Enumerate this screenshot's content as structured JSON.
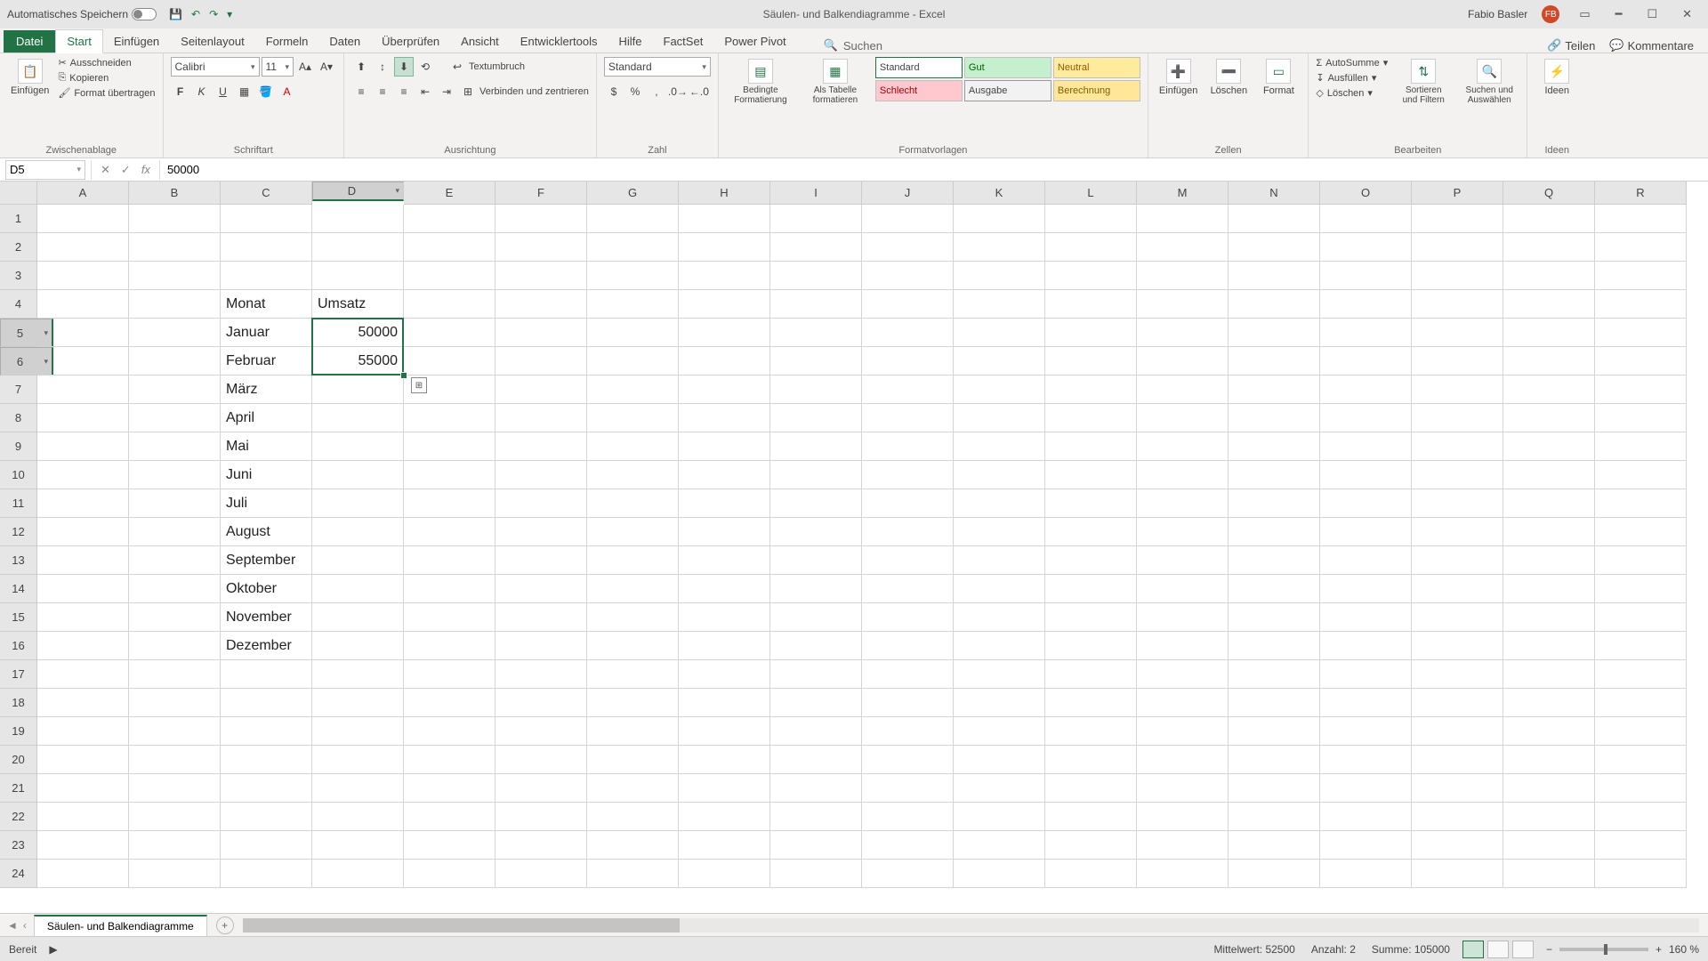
{
  "title": {
    "autosave": "Automatisches Speichern",
    "doc": "Säulen- und Balkendiagramme - Excel",
    "user": "Fabio Basler",
    "initials": "FB"
  },
  "tabs": {
    "file": "Datei",
    "start": "Start",
    "einfuegen": "Einfügen",
    "seitenlayout": "Seitenlayout",
    "formeln": "Formeln",
    "daten": "Daten",
    "ueberpruefen": "Überprüfen",
    "ansicht": "Ansicht",
    "entwickler": "Entwicklertools",
    "hilfe": "Hilfe",
    "factset": "FactSet",
    "powerpivot": "Power Pivot",
    "suchen": "Suchen",
    "teilen": "Teilen",
    "kommentare": "Kommentare"
  },
  "ribbon": {
    "clipboard": {
      "paste": "Einfügen",
      "cut": "Ausschneiden",
      "copy": "Kopieren",
      "formatpainter": "Format übertragen",
      "label": "Zwischenablage"
    },
    "font": {
      "name": "Calibri",
      "size": "11",
      "label": "Schriftart"
    },
    "align": {
      "wrap": "Textumbruch",
      "merge": "Verbinden und zentrieren",
      "label": "Ausrichtung"
    },
    "number": {
      "format": "Standard",
      "label": "Zahl"
    },
    "styles": {
      "cond": "Bedingte Formatierung",
      "table": "Als Tabelle formatieren",
      "s1": "Standard",
      "s2": "Gut",
      "s3": "Neutral",
      "s4": "Schlecht",
      "s5": "Ausgabe",
      "s6": "Berechnung",
      "label": "Formatvorlagen"
    },
    "cells": {
      "insert": "Einfügen",
      "delete": "Löschen",
      "format": "Format",
      "label": "Zellen"
    },
    "editing": {
      "autosum": "AutoSumme",
      "fill": "Ausfüllen",
      "clear": "Löschen",
      "sort": "Sortieren und Filtern",
      "find": "Suchen und Auswählen",
      "label": "Bearbeiten"
    },
    "ideas": {
      "btn": "Ideen",
      "label": "Ideen"
    }
  },
  "fbar": {
    "cellref": "D5",
    "formula": "50000"
  },
  "cols": [
    "A",
    "B",
    "C",
    "D",
    "E",
    "F",
    "G",
    "H",
    "I",
    "J",
    "K",
    "L",
    "M",
    "N",
    "O",
    "P",
    "Q",
    "R"
  ],
  "rows": [
    "1",
    "2",
    "3",
    "4",
    "5",
    "6",
    "7",
    "8",
    "9",
    "10",
    "11",
    "12",
    "13",
    "14",
    "15",
    "16",
    "17",
    "18",
    "19",
    "20",
    "21",
    "22",
    "23",
    "24"
  ],
  "data": {
    "c4": "Monat",
    "d4": "Umsatz",
    "c5": "Januar",
    "d5": "50000",
    "c6": "Februar",
    "d6": "55000",
    "c7": "März",
    "c8": "April",
    "c9": "Mai",
    "c10": "Juni",
    "c11": "Juli",
    "c12": "August",
    "c13": "September",
    "c14": "Oktober",
    "c15": "November",
    "c16": "Dezember"
  },
  "sheet": {
    "name": "Säulen- und Balkendiagramme"
  },
  "status": {
    "ready": "Bereit",
    "avg": "Mittelwert: 52500",
    "count": "Anzahl: 2",
    "sum": "Summe: 105000",
    "zoom": "160 %"
  }
}
